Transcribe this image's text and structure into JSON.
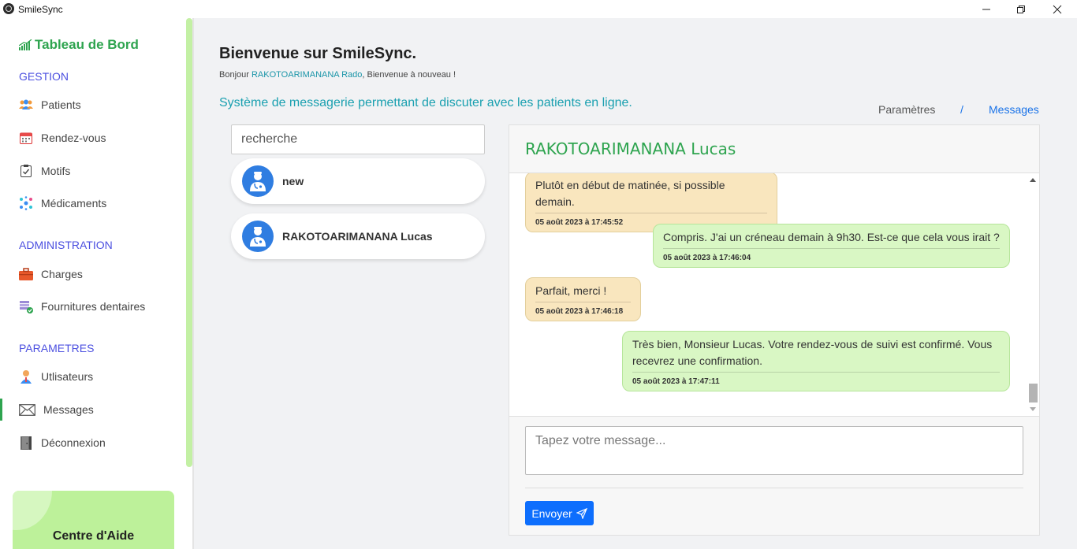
{
  "window": {
    "title": "SmileSync"
  },
  "sidebar": {
    "brand": "Tableau de Bord",
    "sections": {
      "gestion": "GESTION",
      "administration": "ADMINISTRATION",
      "parametres": "PARAMETRES"
    },
    "items": {
      "patients": "Patients",
      "rendezvous": "Rendez-vous",
      "motifs": "Motifs",
      "medicaments": "Médicaments",
      "charges": "Charges",
      "fournitures": "Fournitures dentaires",
      "utilisateurs": "Utlisateurs",
      "messages": "Messages",
      "deconnexion": "Déconnexion"
    },
    "active_item": "Messages",
    "help_title": "Centre d'Aide"
  },
  "header": {
    "title": "Bienvenue sur SmileSync.",
    "greeting_prefix": "Bonjour ",
    "user_name": "RAKOTOARIMANANA Rado",
    "greeting_suffix": ", Bienvenue à nouveau !",
    "description": "Système de messagerie permettant de discuter avec les patients en ligne."
  },
  "breadcrumb": {
    "parent": "Paramètres",
    "separator": "/",
    "current": "Messages"
  },
  "search": {
    "placeholder": "recherche"
  },
  "contacts": [
    {
      "name": "new"
    },
    {
      "name": "RAKOTOARIMANANA Lucas"
    }
  ],
  "chat": {
    "contact_name": "RAKOTOARIMANANA Lucas",
    "messages": [
      {
        "direction": "in",
        "text": "Plutôt en début de matinée, si possible demain.",
        "time": "05 août 2023 à 17:45:52"
      },
      {
        "direction": "out",
        "text": "Compris. J'ai un créneau demain à 9h30. Est-ce que cela vous irait ?",
        "time": "05 août 2023 à 17:46:04"
      },
      {
        "direction": "in",
        "text": "Parfait, merci !",
        "time": "05 août 2023 à 17:46:18"
      },
      {
        "direction": "out",
        "text": "Très bien, Monsieur Lucas. Votre rendez-vous de suivi est confirmé. Vous recevrez une confirmation.",
        "time": "05 août 2023 à 17:47:11"
      }
    ],
    "composer_placeholder": "Tapez votre message...",
    "send_label": "Envoyer"
  },
  "colors": {
    "brand_green": "#2ea44f",
    "section_blue": "#4b4fe0",
    "teal": "#1aa0b0",
    "link_blue": "#1a73e8",
    "incoming_bubble": "#f9e6be",
    "outgoing_bubble": "#d9f7c4",
    "send_button": "#0d6efd",
    "help_card": "#bdf19a"
  }
}
